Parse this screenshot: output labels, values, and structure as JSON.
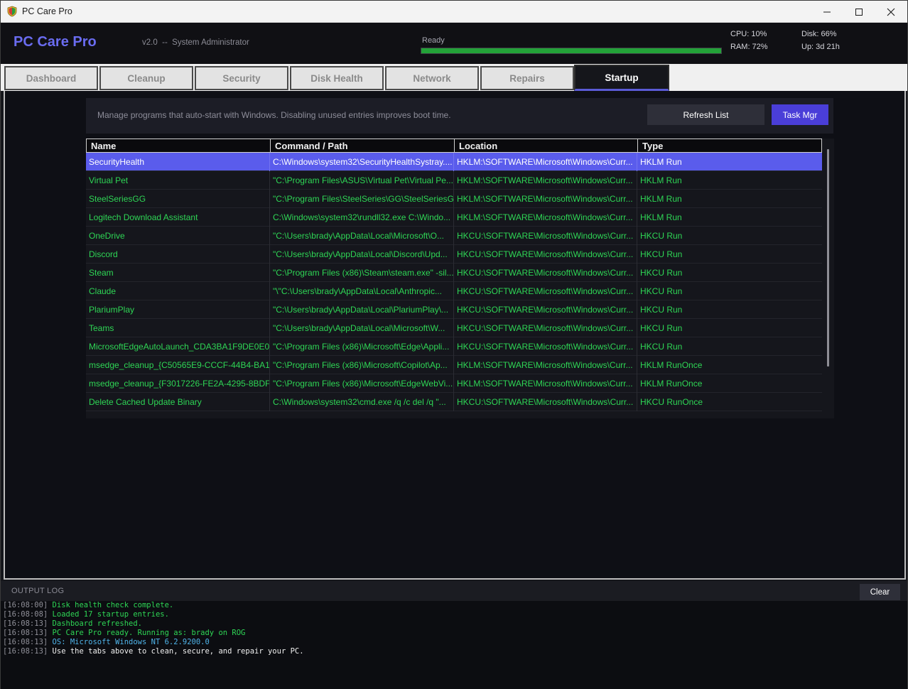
{
  "window": {
    "title": "PC Care Pro",
    "controls": [
      "minimize",
      "maximize",
      "close"
    ]
  },
  "header": {
    "brand": "PC Care Pro",
    "subtitle": "v2.0  --  System Administrator",
    "status": "Ready",
    "progress_percent": 100,
    "metrics": {
      "cpu": "CPU: 10%",
      "ram": "RAM: 72%",
      "disk": "Disk: 66%",
      "uptime": "Up: 3d 21h"
    }
  },
  "tabs": [
    {
      "label": "Dashboard",
      "active": false
    },
    {
      "label": "Cleanup",
      "active": false
    },
    {
      "label": "Security",
      "active": false
    },
    {
      "label": "Disk Health",
      "active": false
    },
    {
      "label": "Network",
      "active": false
    },
    {
      "label": "Repairs",
      "active": false
    },
    {
      "label": "Startup",
      "active": true
    }
  ],
  "startup": {
    "description": "Manage programs that auto-start with Windows. Disabling unused entries improves boot time.",
    "refresh_label": "Refresh List",
    "taskmgr_label": "Task Mgr",
    "columns": [
      "Name",
      "Command / Path",
      "Location",
      "Type"
    ],
    "rows": [
      [
        "SecurityHealth",
        "C:\\Windows\\system32\\SecurityHealthSystray....",
        "HKLM:\\SOFTWARE\\Microsoft\\Windows\\Curr...",
        "HKLM Run"
      ],
      [
        "Virtual Pet",
        "\"C:\\Program Files\\ASUS\\Virtual Pet\\Virtual Pe...",
        "HKLM:\\SOFTWARE\\Microsoft\\Windows\\Curr...",
        "HKLM Run"
      ],
      [
        "SteelSeriesGG",
        "\"C:\\Program Files\\SteelSeries\\GG\\SteelSeriesG...",
        "HKLM:\\SOFTWARE\\Microsoft\\Windows\\Curr...",
        "HKLM Run"
      ],
      [
        "Logitech Download Assistant",
        "C:\\Windows\\system32\\rundll32.exe C:\\Windo...",
        "HKLM:\\SOFTWARE\\Microsoft\\Windows\\Curr...",
        "HKLM Run"
      ],
      [
        "OneDrive",
        "\"C:\\Users\\brady\\AppData\\Local\\Microsoft\\O...",
        "HKCU:\\SOFTWARE\\Microsoft\\Windows\\Curr...",
        "HKCU Run"
      ],
      [
        "Discord",
        "\"C:\\Users\\brady\\AppData\\Local\\Discord\\Upd...",
        "HKCU:\\SOFTWARE\\Microsoft\\Windows\\Curr...",
        "HKCU Run"
      ],
      [
        "Steam",
        "\"C:\\Program Files (x86)\\Steam\\steam.exe\" -sil...",
        "HKCU:\\SOFTWARE\\Microsoft\\Windows\\Curr...",
        "HKCU Run"
      ],
      [
        "Claude",
        "\"\\\"C:\\Users\\brady\\AppData\\Local\\Anthropic...",
        "HKCU:\\SOFTWARE\\Microsoft\\Windows\\Curr...",
        "HKCU Run"
      ],
      [
        "PlariumPlay",
        "\"C:\\Users\\brady\\AppData\\Local\\PlariumPlay\\...",
        "HKCU:\\SOFTWARE\\Microsoft\\Windows\\Curr...",
        "HKCU Run"
      ],
      [
        "Teams",
        "\"C:\\Users\\brady\\AppData\\Local\\Microsoft\\W...",
        "HKCU:\\SOFTWARE\\Microsoft\\Windows\\Curr...",
        "HKCU Run"
      ],
      [
        "MicrosoftEdgeAutoLaunch_CDA3BA1F9DE0E0...",
        "\"C:\\Program Files (x86)\\Microsoft\\Edge\\Appli...",
        "HKCU:\\SOFTWARE\\Microsoft\\Windows\\Curr...",
        "HKCU Run"
      ],
      [
        "msedge_cleanup_{C50565E9-CCCF-44B4-BA1...",
        "\"C:\\Program Files (x86)\\Microsoft\\Copilot\\Ap...",
        "HKLM:\\SOFTWARE\\Microsoft\\Windows\\Curr...",
        "HKLM RunOnce"
      ],
      [
        "msedge_cleanup_{F3017226-FE2A-4295-8BDF...",
        "\"C:\\Program Files (x86)\\Microsoft\\EdgeWebVi...",
        "HKLM:\\SOFTWARE\\Microsoft\\Windows\\Curr...",
        "HKLM RunOnce"
      ],
      [
        "Delete Cached Update Binary",
        "C:\\Windows\\system32\\cmd.exe /q /c del /q \"...",
        "HKCU:\\SOFTWARE\\Microsoft\\Windows\\Curr...",
        "HKCU RunOnce"
      ]
    ],
    "selected_row": 0
  },
  "log": {
    "title": "OUTPUT LOG",
    "clear_label": "Clear",
    "lines": [
      {
        "ts": "[16:08:00]",
        "msg": "Disk health check complete.",
        "color": "#2ed655"
      },
      {
        "ts": "[16:08:08]",
        "msg": "Loaded 17 startup entries.",
        "color": "#2ed655"
      },
      {
        "ts": "[16:08:13]",
        "msg": "Dashboard refreshed.",
        "color": "#2ed655"
      },
      {
        "ts": "[16:08:13]",
        "msg": "PC Care Pro ready. Running as: brady on ROG",
        "color": "#2ed655"
      },
      {
        "ts": "[16:08:13]",
        "msg": "OS: Microsoft Windows NT 6.2.9200.0",
        "color": "#4fb3e8"
      },
      {
        "ts": "[16:08:13]",
        "msg": "Use the tabs above to clean, secure, and repair your PC.",
        "color": "#f0f0f0"
      }
    ]
  },
  "colors": {
    "accent": "#5a5cec",
    "brand": "#6a6cf0",
    "ok_text": "#2ed655",
    "progress": "#23a238",
    "info_text": "#4fb3e8"
  }
}
